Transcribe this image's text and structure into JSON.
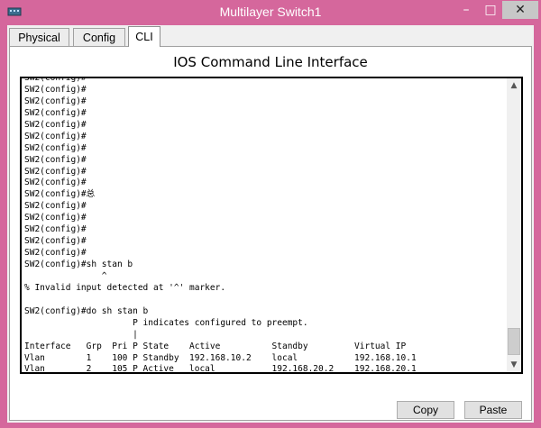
{
  "window": {
    "title": "Multilayer Switch1",
    "controls": {
      "minimize": "–",
      "maximize": "□",
      "close": "✕"
    }
  },
  "tabs": [
    {
      "label": "Physical",
      "active": false
    },
    {
      "label": "Config",
      "active": false
    },
    {
      "label": "CLI",
      "active": true
    }
  ],
  "cli": {
    "header": "IOS Command Line Interface",
    "lines": [
      "SW2(config)#",
      "SW2(config)#",
      "SW2(config)#",
      "SW2(config)#",
      "SW2(config)#",
      "SW2(config)#",
      "SW2(config)#",
      "SW2(config)#",
      "SW2(config)#",
      "SW2(config)#",
      "SW2(config)#总",
      "SW2(config)#",
      "SW2(config)#",
      "SW2(config)#",
      "SW2(config)#",
      "SW2(config)#",
      "SW2(config)#sh stan b",
      "               ^",
      "% Invalid input detected at '^' marker.",
      "",
      "SW2(config)#do sh stan b",
      "                     P indicates configured to preempt.",
      "                     |",
      "Interface   Grp  Pri P State    Active          Standby         Virtual IP",
      "Vlan        1    100 P Standby  192.168.10.2    local           192.168.10.1",
      "Vlan        2    105 P Active   local           192.168.20.2    192.168.20.1",
      "SW2(config)#"
    ]
  },
  "buttons": {
    "copy": "Copy",
    "paste": "Paste"
  },
  "icons": {
    "app": "switch-icon",
    "scroll_up": "chevron-up-icon",
    "scroll_down": "chevron-down-icon"
  }
}
